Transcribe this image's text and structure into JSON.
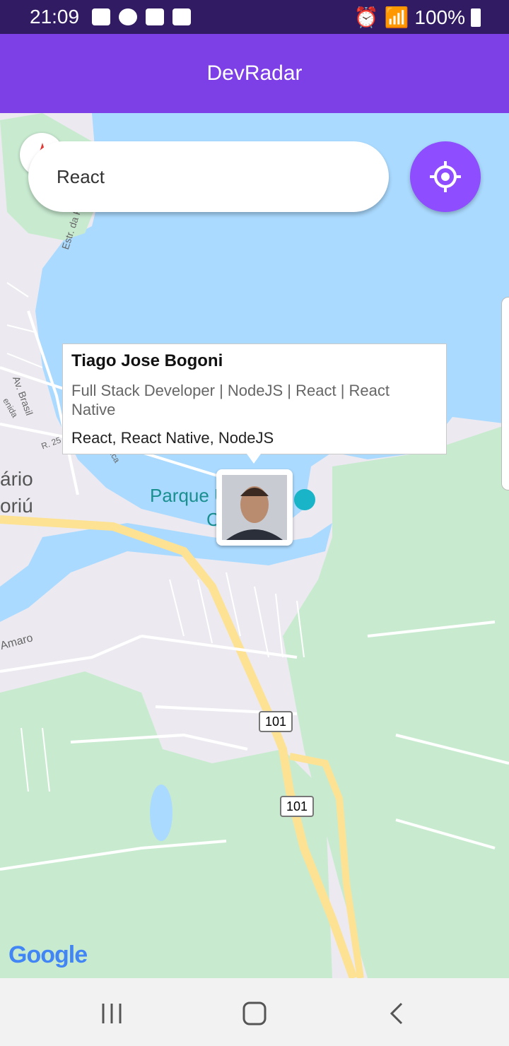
{
  "status_bar": {
    "time": "21:09",
    "battery": "100%",
    "icons_left": [
      "voicemail-icon",
      "a-icon",
      "clock-icon",
      "image-icon"
    ],
    "icons_right": [
      "alarm-icon",
      "wifi-icon",
      "signal-icon",
      "battery-icon"
    ]
  },
  "app": {
    "title": "DevRadar"
  },
  "search": {
    "value": "React"
  },
  "map": {
    "labels": {
      "place_left1": "ário",
      "place_left2": "oriú",
      "park": "Parque U",
      "park2": "C",
      "route1": "101",
      "route2": "101",
      "street_brasil": "Av. Brasil",
      "street_estr": "Estr. da R",
      "street_amaro": "Amaro",
      "street_r": "R. 25",
      "street_ida": "enida",
      "street_ica": "ica",
      "google": "Google"
    }
  },
  "dev": {
    "name": "Tiago Jose Bogoni",
    "bio": "Full Stack Developer | NodeJS | React | React Native",
    "techs": "React, React Native, NodeJS"
  },
  "colors": {
    "primary": "#7d40e7",
    "water": "#aadaff",
    "park": "#c8ebd0",
    "road": "#fde293"
  }
}
